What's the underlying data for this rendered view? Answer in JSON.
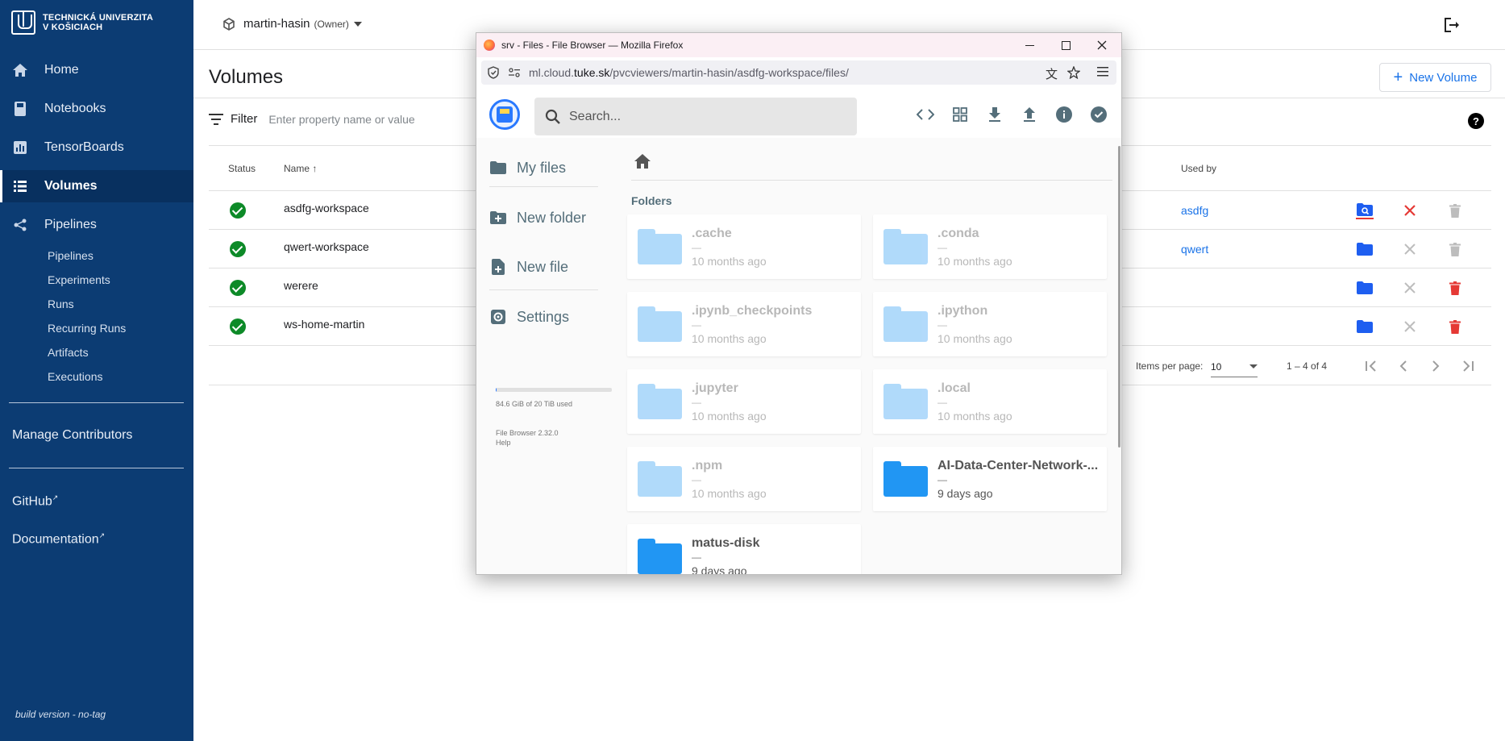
{
  "sidebar": {
    "logo_line1": "TECHNICKÁ UNIVERZITA",
    "logo_line2": "V KOŠICIACH",
    "nav": [
      {
        "label": "Home",
        "icon": "home-icon"
      },
      {
        "label": "Notebooks",
        "icon": "book-icon"
      },
      {
        "label": "TensorBoards",
        "icon": "chart-icon"
      },
      {
        "label": "Volumes",
        "icon": "list-icon",
        "active": true
      },
      {
        "label": "Pipelines",
        "icon": "pipelines-icon"
      }
    ],
    "sub_items": [
      "Pipelines",
      "Experiments",
      "Runs",
      "Recurring Runs",
      "Artifacts",
      "Executions"
    ],
    "manage": "Manage Contributors",
    "github": "GitHub",
    "documentation": "Documentation",
    "build": "build version - no-tag"
  },
  "topbar": {
    "namespace": "martin-hasin",
    "owner": "(Owner)"
  },
  "volumes": {
    "title": "Volumes",
    "new_button": "New Volume",
    "filter_label": "Filter",
    "filter_placeholder": "Enter property name or value",
    "columns": {
      "status": "Status",
      "name": "Name",
      "used_by": "Used by"
    },
    "rows": [
      {
        "name": "asdfg-workspace",
        "used_by": "asdfg"
      },
      {
        "name": "qwert-workspace",
        "used_by": "qwert"
      },
      {
        "name": "werere",
        "used_by": ""
      },
      {
        "name": "ws-home-martin",
        "used_by": ""
      }
    ],
    "pager": {
      "items_label": "Items per page:",
      "items_value": "10",
      "range": "1 – 4 of 4"
    }
  },
  "firefox": {
    "title": "srv - Files - File Browser — Mozilla Firefox",
    "url_prefix": "ml.cloud.",
    "url_domain": "tuke.sk",
    "url_path": "/pvcviewers/martin-hasin/asdfg-workspace/files/"
  },
  "filebrowser": {
    "search_placeholder": "Search...",
    "nav": {
      "my_files": "My files",
      "new_folder": "New folder",
      "new_file": "New file",
      "settings": "Settings"
    },
    "usage_fraction": 0.004,
    "usage": "84.6 GiB of 20 TiB used",
    "version": "File Browser 2.32.0",
    "help": "Help",
    "folders_label": "Folders",
    "folders": [
      {
        "name": ".cache",
        "meta": "—",
        "date": "10 months ago",
        "hidden": true
      },
      {
        "name": ".conda",
        "meta": "—",
        "date": "10 months ago",
        "hidden": true
      },
      {
        "name": ".ipynb_checkpoints",
        "meta": "—",
        "date": "10 months ago",
        "hidden": true
      },
      {
        "name": ".ipython",
        "meta": "—",
        "date": "10 months ago",
        "hidden": true
      },
      {
        "name": ".jupyter",
        "meta": "—",
        "date": "10 months ago",
        "hidden": true
      },
      {
        "name": ".local",
        "meta": "—",
        "date": "10 months ago",
        "hidden": true
      },
      {
        "name": ".npm",
        "meta": "—",
        "date": "10 months ago",
        "hidden": true
      },
      {
        "name": "AI-Data-Center-Network-...",
        "meta": "—",
        "date": "9 days ago",
        "hidden": false
      },
      {
        "name": "matus-disk",
        "meta": "—",
        "date": "9 days ago",
        "hidden": false
      }
    ]
  }
}
